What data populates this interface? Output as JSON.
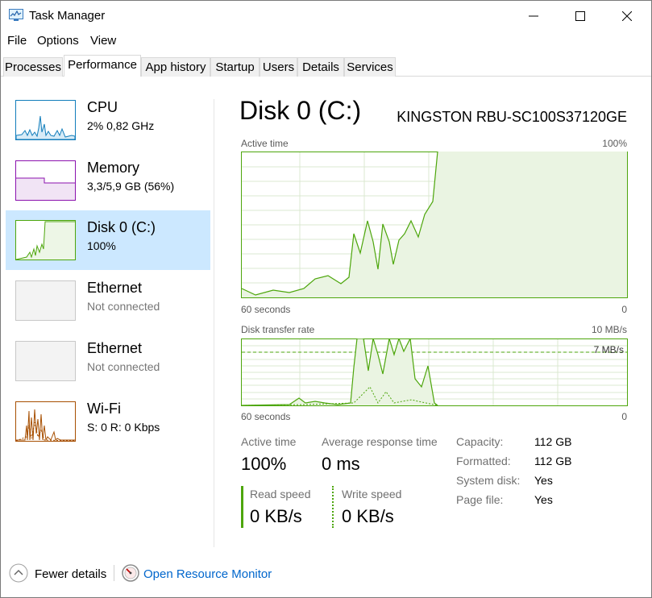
{
  "window": {
    "title": "Task Manager",
    "app_icon": "task-manager-icon"
  },
  "menu": {
    "file": "File",
    "options": "Options",
    "view": "View"
  },
  "tabs": [
    {
      "label": "Processes"
    },
    {
      "label": "Performance"
    },
    {
      "label": "App history"
    },
    {
      "label": "Startup"
    },
    {
      "label": "Users"
    },
    {
      "label": "Details"
    },
    {
      "label": "Services"
    }
  ],
  "active_tab": "Performance",
  "sidebar": {
    "items": [
      {
        "title": "CPU",
        "sub": "2%  0,82 GHz",
        "color": "#117dbb"
      },
      {
        "title": "Memory",
        "sub": "3,3/5,9 GB (56%)",
        "color": "#8b12ae"
      },
      {
        "title": "Disk 0 (C:)",
        "sub": "100%",
        "color": "#4da60c",
        "selected": true
      },
      {
        "title": "Ethernet",
        "sub": "Not connected",
        "color": "#a0a0a0"
      },
      {
        "title": "Ethernet",
        "sub": "Not connected",
        "color": "#a0a0a0"
      },
      {
        "title": "Wi-Fi",
        "sub": "S: 0  R: 0 Kbps",
        "color": "#a74f01"
      }
    ]
  },
  "main": {
    "title": "Disk 0 (C:)",
    "model": "KINGSTON RBU-SC100S37120GE",
    "active_graph": {
      "label": "Active time",
      "max": "100%",
      "time": "60 seconds",
      "min": "0",
      "current_percent": 100
    },
    "transfer_graph": {
      "label": "Disk transfer rate",
      "max": "10 MB/s",
      "marker": "7 MB/s",
      "time": "60 seconds",
      "min": "0"
    },
    "stats": {
      "active_time_label": "Active time",
      "active_time_value": "100%",
      "avg_response_label": "Average response time",
      "avg_response_value": "0 ms",
      "read_speed_label": "Read speed",
      "read_speed_value": "0 KB/s",
      "write_speed_label": "Write speed",
      "write_speed_value": "0 KB/s"
    },
    "properties": [
      {
        "label": "Capacity:",
        "value": "112 GB"
      },
      {
        "label": "Formatted:",
        "value": "112 GB"
      },
      {
        "label": "System disk:",
        "value": "Yes"
      },
      {
        "label": "Page file:",
        "value": "Yes"
      }
    ],
    "accent_color": "#4da60c"
  },
  "footer": {
    "fewer_details": "Fewer details",
    "resource_monitor": "Open Resource Monitor"
  }
}
